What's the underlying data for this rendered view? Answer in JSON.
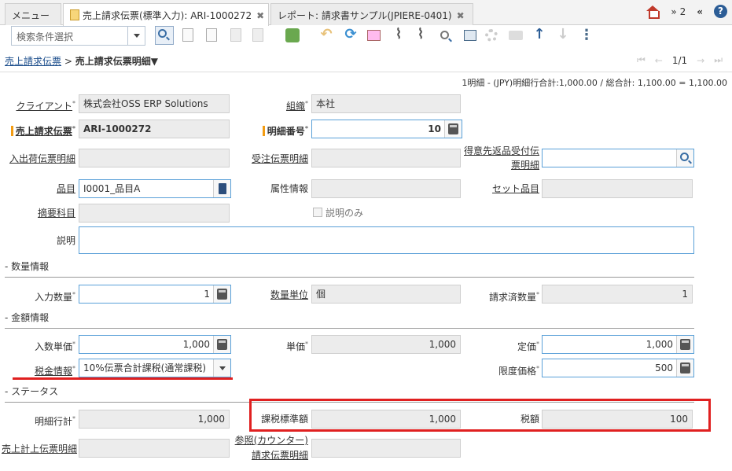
{
  "tabs": [
    {
      "label": "メニュー"
    },
    {
      "label": "売上請求伝票(標準入力): ARI-1000272"
    },
    {
      "label": "レポート: 請求書サンプル(JPIERE-0401)"
    }
  ],
  "header": {
    "notification_count": "2",
    "help": "?"
  },
  "toolbar": {
    "search_placeholder": "検索条件選択"
  },
  "breadcrumb": {
    "parent": "売上請求伝票",
    "separator": ">",
    "current": "売上請求伝票明細"
  },
  "pager": {
    "position": "1/1"
  },
  "summary": "1明細 - (JPY)明細行合計:1,000.00 / 総合計: 1,100.00 = 1,100.00",
  "fields": {
    "client": {
      "label": "クライアント",
      "value": "株式会社OSS ERP Solutions"
    },
    "org": {
      "label": "組織",
      "value": "本社"
    },
    "invoice": {
      "label": "売上請求伝票",
      "value": "ARI-1000272"
    },
    "line_no": {
      "label": "明細番号",
      "value": "10"
    },
    "shipment_line": {
      "label": "入出荷伝票明細",
      "value": ""
    },
    "order_line": {
      "label": "受注伝票明細",
      "value": ""
    },
    "rma_line_1": {
      "label": "得意先返品受付伝",
      "value": ""
    },
    "rma_line_2": {
      "label": "票明細"
    },
    "product": {
      "label": "品目",
      "value": "I0001_品目A"
    },
    "attribute": {
      "label": "属性情報",
      "value": ""
    },
    "set_product": {
      "label": "セット品目",
      "value": ""
    },
    "summary_account": {
      "label": "摘要科目",
      "value": ""
    },
    "description_only": {
      "label": "説明のみ"
    },
    "description": {
      "label": "説明",
      "value": ""
    },
    "qty_entered": {
      "label": "入力数量",
      "value": "1"
    },
    "uom": {
      "label": "数量単位",
      "value": "個"
    },
    "qty_invoiced": {
      "label": "請求済数量",
      "value": "1"
    },
    "price_entered": {
      "label": "入数単価",
      "value": "1,000"
    },
    "unit_price": {
      "label": "単価",
      "value": "1,000"
    },
    "list_price": {
      "label": "定価",
      "value": "1,000"
    },
    "tax": {
      "label": "税金情報",
      "value": "10%伝票合計課税(通常課税)"
    },
    "limit_price": {
      "label": "限度価格",
      "value": "500"
    },
    "line_total": {
      "label": "明細行計",
      "value": "1,000"
    },
    "taxable_amount": {
      "label": "課税標準額",
      "value": "1,000"
    },
    "tax_amount": {
      "label": "税額",
      "value": "100"
    },
    "invoice_line_ref": {
      "label": "売上計上伝票明細",
      "value": ""
    },
    "counter_ref_1": {
      "label": "参照(カウンター)"
    },
    "counter_ref_2": {
      "label": "請求伝票明細",
      "value": ""
    }
  },
  "sections": {
    "qty": "- 数量情報",
    "amount": "- 金額情報",
    "status": "- ステータス"
  },
  "colors": {
    "highlight": "#e02020",
    "mandatory_mark": "#f39c12",
    "link": "#1a4c8b"
  }
}
